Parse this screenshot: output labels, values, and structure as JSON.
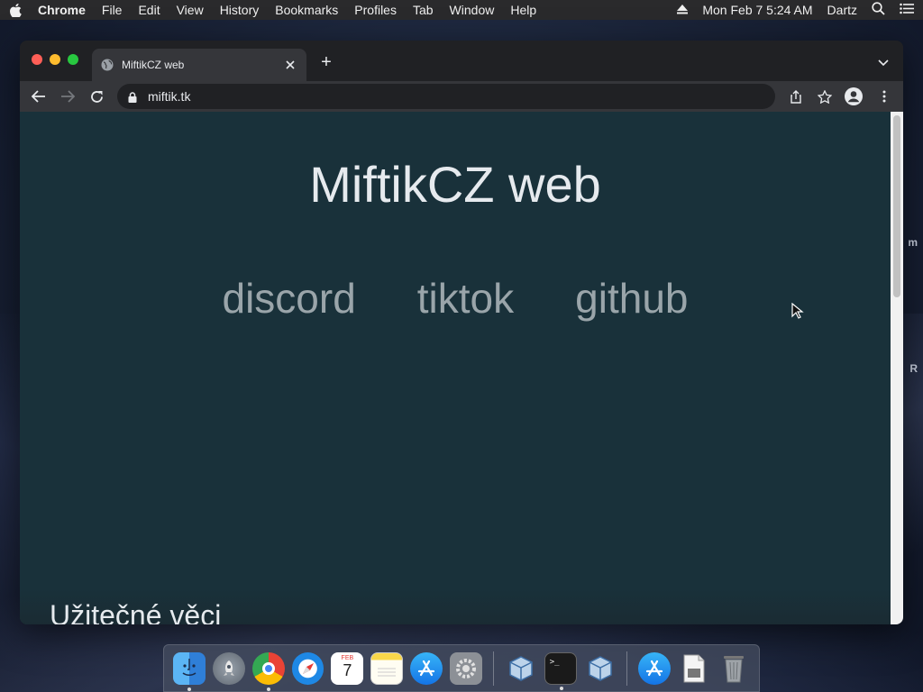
{
  "menubar": {
    "app_name": "Chrome",
    "items": [
      "File",
      "Edit",
      "View",
      "History",
      "Bookmarks",
      "Profiles",
      "Tab",
      "Window",
      "Help"
    ],
    "clock": "Mon Feb 7  5:24 AM",
    "user": "Dartz"
  },
  "browser": {
    "tab_title": "MiftikCZ web",
    "new_tab_label": "+",
    "url": "miftik.tk"
  },
  "page": {
    "title": "MiftikCZ web",
    "links": [
      "discord",
      "tiktok",
      "github"
    ],
    "section_heading": "Užitečné věci",
    "background_color": "#19313a",
    "link_color": "#9aa5aa"
  },
  "desktop": {
    "edge_text_top": "m",
    "edge_text_bottom": "R"
  },
  "dock": {
    "items": [
      {
        "name": "Finder",
        "icon": "finder-icon",
        "running": true
      },
      {
        "name": "Launchpad",
        "icon": "launchpad-icon",
        "running": false
      },
      {
        "name": "Google Chrome",
        "icon": "chrome-icon",
        "running": true
      },
      {
        "name": "Safari",
        "icon": "safari-icon",
        "running": false
      },
      {
        "name": "Calendar",
        "icon": "calendar-icon",
        "running": false,
        "month": "FEB",
        "day": "7"
      },
      {
        "name": "Notes",
        "icon": "notes-icon",
        "running": false
      },
      {
        "name": "App Store",
        "icon": "app-store-icon",
        "running": false
      },
      {
        "name": "System Preferences",
        "icon": "system-preferences-icon",
        "running": false
      },
      {
        "name": "VirtualBox",
        "icon": "virtualbox-icon",
        "running": false
      },
      {
        "name": "Terminal",
        "icon": "terminal-icon",
        "running": true
      },
      {
        "name": "VirtualBox VM",
        "icon": "virtualbox-vm-icon",
        "running": false
      },
      {
        "name": "App Store Downloads",
        "icon": "app-store-downloads-icon",
        "running": false
      },
      {
        "name": "Document",
        "icon": "document-icon",
        "running": false
      },
      {
        "name": "Trash",
        "icon": "trash-icon",
        "running": false
      }
    ]
  }
}
